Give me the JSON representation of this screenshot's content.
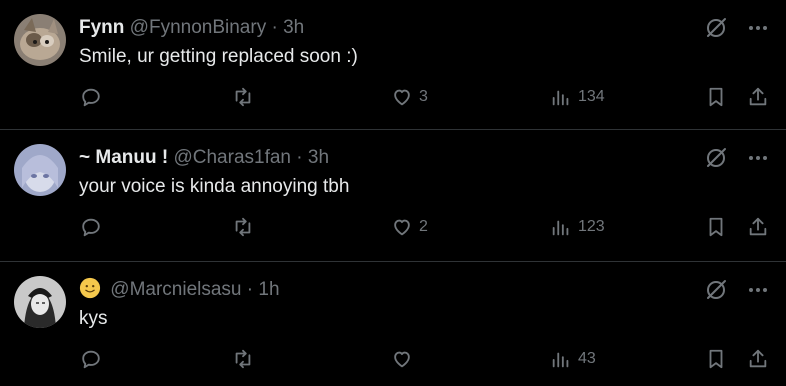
{
  "posts": [
    {
      "name": "Fynn",
      "handle": "@FynnonBinary",
      "dot": "·",
      "time": "3h",
      "text": "Smile, ur getting replaced soon :)",
      "likes": "3",
      "views": "134"
    },
    {
      "name": "~ Manuu !",
      "handle": "@Charas1fan",
      "dot": "·",
      "time": "3h",
      "text": "your voice is kinda annoying tbh",
      "likes": "2",
      "views": "123"
    },
    {
      "name": "",
      "handle": "@Marcnielsasu",
      "dot": "·",
      "time": "1h",
      "text": "kys",
      "likes": "",
      "views": "43"
    }
  ],
  "icons": {
    "reply": "reply-icon",
    "repost": "repost-icon",
    "like": "heart-icon",
    "views": "views-icon",
    "bookmark": "bookmark-icon",
    "share": "share-icon",
    "grok": "grok-icon",
    "more": "more-icon"
  },
  "colors": {
    "background": "#000000",
    "text": "#e7e9ea",
    "muted": "#71767b",
    "divider": "#2f3336"
  }
}
